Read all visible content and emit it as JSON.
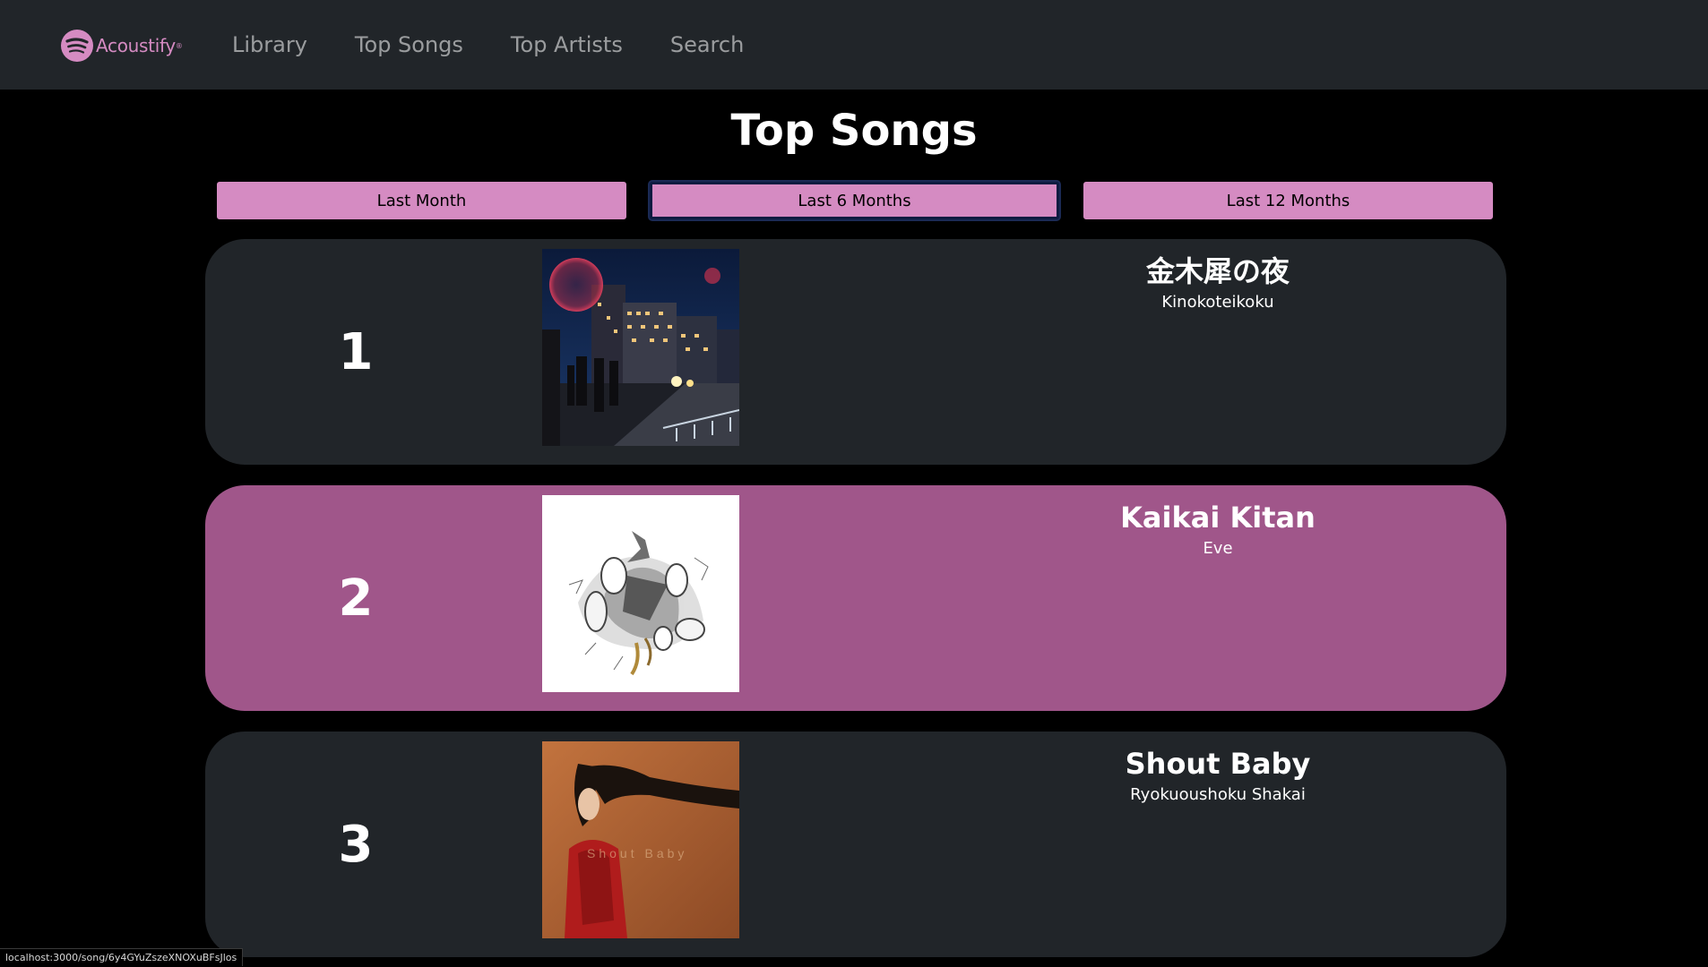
{
  "colors": {
    "nav_bg": "#212529",
    "accent": "#d58bc2",
    "card_bg": "#212529",
    "card_highlight": "#a0568a",
    "page_bg": "#000000"
  },
  "navbar": {
    "brand_text": "Acoustify",
    "brand_tm": "®",
    "brand_icon": "spotify-logo-icon",
    "links": [
      "Library",
      "Top Songs",
      "Top Artists",
      "Search"
    ]
  },
  "main": {
    "title": "Top Songs",
    "time_ranges": [
      {
        "label": "Last Month",
        "active": false
      },
      {
        "label": "Last 6 Months",
        "active": true
      },
      {
        "label": "Last 12 Months",
        "active": false
      }
    ],
    "songs": [
      {
        "rank": "1",
        "title": "金木犀の夜",
        "artist": "Kinokoteikoku",
        "highlighted": false
      },
      {
        "rank": "2",
        "title": "Kaikai Kitan",
        "artist": "Eve",
        "highlighted": true
      },
      {
        "rank": "3",
        "title": "Shout Baby",
        "artist": "Ryokuoushoku Shakai",
        "highlighted": false
      }
    ]
  },
  "status_bar": {
    "url": "localhost:3000/song/6y4GYuZszeXNOXuBFsJlos"
  }
}
